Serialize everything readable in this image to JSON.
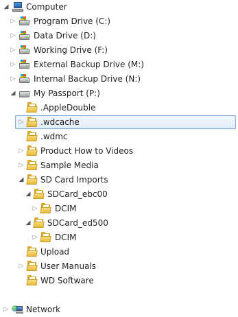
{
  "tree": {
    "computer": "Computer",
    "drives": [
      {
        "label": "Program Drive (C:)"
      },
      {
        "label": "Data Drive (D:)"
      },
      {
        "label": "Working Drive (F:)"
      },
      {
        "label": "External Backup Drive (M:)"
      },
      {
        "label": "Internal Backup Drive (N:)"
      },
      {
        "label": "My Passport (P:)"
      }
    ],
    "passport_folders": {
      "apple_double": ".AppleDouble",
      "wdcache": ".wdcache",
      "wdmc": ".wdmc",
      "product_videos": "Product How to Videos",
      "sample_media": "Sample Media",
      "sd_card_imports": "SD Card Imports",
      "sdcard_ebc00": "SDCard_ebc00",
      "dcim_1": "DCIM",
      "sdcard_ed500": "SDCard_ed500",
      "dcim_2": "DCIM",
      "upload": "Upload",
      "user_manuals": "User Manuals",
      "wd_software": "WD Software"
    },
    "network": "Network",
    "selected_item": ".wdcache"
  },
  "icons": {
    "expanded_arrow": "expanded-triangle-icon",
    "collapsed_arrow": "collapsed-triangle-icon",
    "folder": "folder-icon",
    "drive": "drive-icon",
    "computer": "computer-icon",
    "network": "network-icon"
  },
  "colors": {
    "selection_border": "#84acdd",
    "selection_fill": "#e8f0fb",
    "folder": "#e9bb3c"
  }
}
